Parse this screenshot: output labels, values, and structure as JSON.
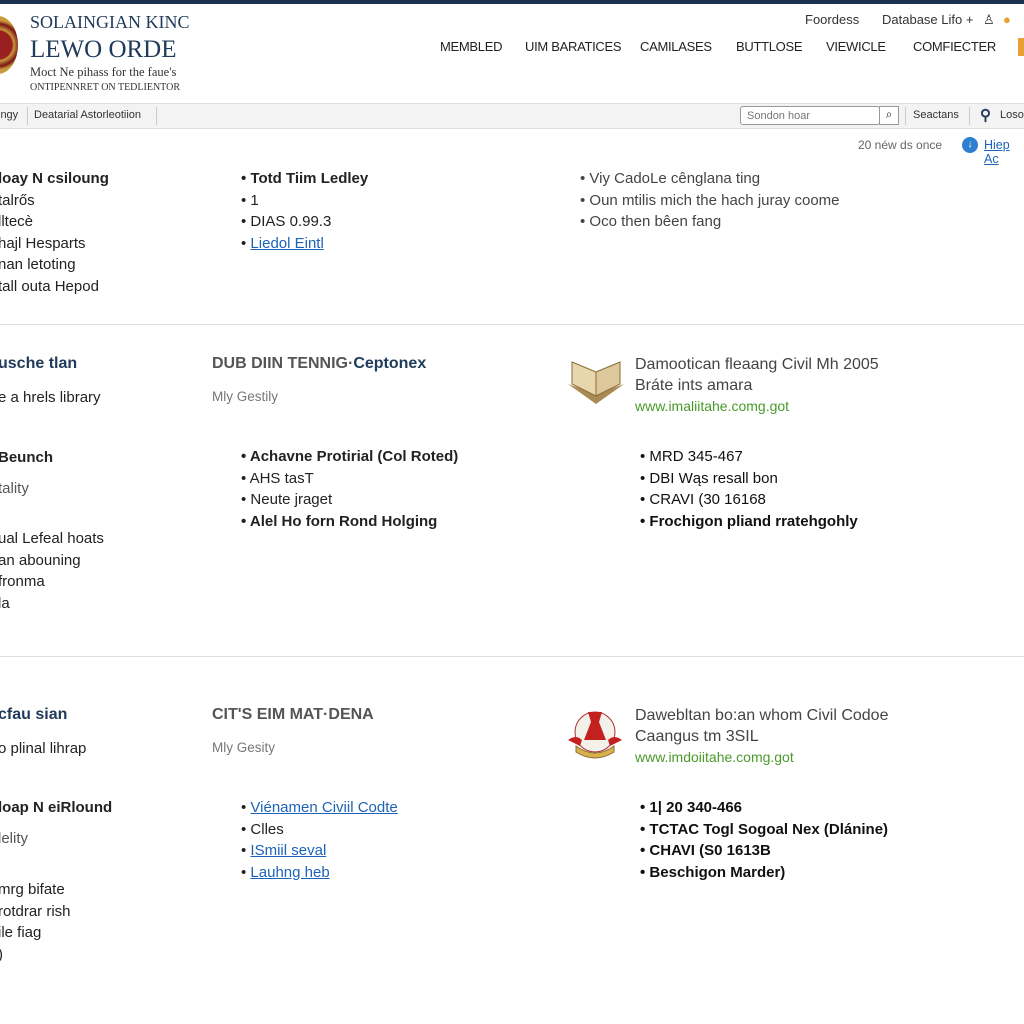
{
  "header": {
    "logo": [
      "SOLAINGIAN KINC",
      "LEWO ORDE",
      "Moct Ne pihass for the faue's",
      "ONTIPENNRET ON TEDLIENTOR"
    ],
    "util": [
      "Foordess",
      "Database Lifo +"
    ],
    "nav": [
      "MEMBLED",
      "UIM BARATICES",
      "CAMILASES",
      "BUTTLOSE",
      "VIEWICLE",
      "COMFIECTER"
    ]
  },
  "subbar": {
    "crumbs": [
      "ingy",
      "Deatarial Astorleotiion"
    ],
    "search_placeholder": "Sondon hoar",
    "search_label": "Seactans",
    "login": "Loso"
  },
  "notice": {
    "text": "20 néw ds once",
    "help": "Hiep Ac"
  },
  "sections": [
    {
      "left_title": "loay N csiloung",
      "left_items": [
        "talrős",
        "lltecè",
        "hajl Hesparts",
        "nan letoting",
        "tall outa Hepod"
      ],
      "mid_items": [
        "Totd Tiim Ledley",
        "1",
        "DIAS 0.99.3",
        "Liedol Eintl"
      ],
      "right_items": [
        "Viy CadoLe cênglana ting",
        "Oun mtilis mich the hach juray coome",
        "Oco then bêen fang"
      ]
    },
    {
      "left_title": "usche tlan",
      "left_sub": "e a hrels library",
      "left_title2": "Beunch",
      "left_sub2": "tality",
      "left_items": [
        "ual Lefeal hoats",
        "an abouning",
        "fronma",
        "la"
      ],
      "mid_title": "DUB DIIN TENNIG·",
      "mid_title_accent": "Ceptonex",
      "mid_sub": "Mly Gestily",
      "mid_items": [
        "Achavne Protirial (Col Roted)",
        "AHS tasT",
        "Neute jraget",
        "Alel Ho forn Rond Holging"
      ],
      "right_lines": [
        "Damootican fleaang Civil Mh 2005",
        "Bráte ints amara"
      ],
      "right_url": "www.imaliitahe.comg.got",
      "right_items": [
        "MRD 345-467",
        "DBI Wąs resall bon",
        "CRAVI (30 16168",
        "Frochigon pliand rratehgohly"
      ]
    },
    {
      "left_title": "cfau sian",
      "left_sub": "o plinal lihrap",
      "left_title2": "loap N eiRlound",
      "left_sub2": "lelity",
      "left_items": [
        "mrg bifate",
        "rotdrar rish",
        "ile fiag",
        ")"
      ],
      "mid_title": "CIT'S EIM MAT·DENA",
      "mid_sub": "Mly Gesity",
      "mid_items": [
        "Viénamen Civiil Codte",
        "Clles",
        "ISmiil seval",
        "Lauhng heb"
      ],
      "right_lines": [
        "Dawebltan bo:an whom Civil Codoe",
        "Caangus tm 3SIL"
      ],
      "right_url": "www.imdoiitahe.comg.got",
      "right_items": [
        "1| 20 340-466",
        "TCTAC Togl Sogoal Nex (Dlánine)",
        "CHAVI (S0 1613B",
        "Beschigon Marder)"
      ]
    }
  ]
}
